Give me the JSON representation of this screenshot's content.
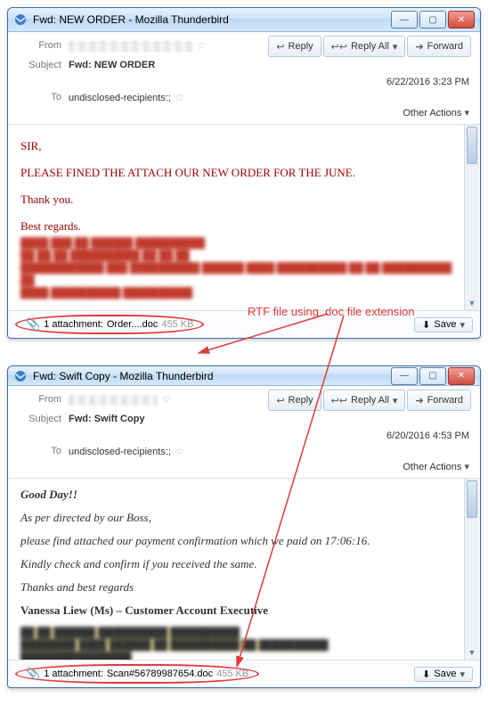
{
  "annotation": {
    "label": "RTF file using .doc file extension"
  },
  "email1": {
    "titlebar": "Fwd: NEW ORDER - Mozilla Thunderbird",
    "header": {
      "from_label": "From",
      "subject_label": "Subject",
      "subject_value": "Fwd: NEW ORDER",
      "to_label": "To",
      "to_value": "undisclosed-recipients:;",
      "reply": "Reply",
      "reply_all": "Reply All",
      "forward": "Forward",
      "date": "6/22/2016 3:23 PM",
      "other_actions": "Other Actions"
    },
    "body": {
      "line1": "SIR,",
      "line2": "PLEASE FINED THE ATTACH OUR NEW ORDER FOR THE JUNE.",
      "line3": "Thank you.",
      "line4": "Best regards."
    },
    "attachment": {
      "count_label": "1 attachment:",
      "filename": "Order....doc",
      "size": "455 KB",
      "save_label": "Save"
    }
  },
  "email2": {
    "titlebar": "Fwd: Swift Copy - Mozilla Thunderbird",
    "header": {
      "from_label": "From",
      "subject_label": "Subject",
      "subject_value": "Fwd: Swift Copy",
      "to_label": "To",
      "to_value": "undisclosed-recipients:;",
      "reply": "Reply",
      "reply_all": "Reply All",
      "forward": "Forward",
      "date": "6/20/2016 4:53 PM",
      "other_actions": "Other Actions"
    },
    "body": {
      "line1": "Good Day!!",
      "line2": "As per directed by our Boss,",
      "line3": "please find attached our payment confirmation which we paid on 17:06:16.",
      "line4": "Kindly check and confirm if you received the same.",
      "line5": "Thanks and best regards",
      "line6": "Vanessa Liew (Ms) – Customer Account Executive"
    },
    "attachment": {
      "count_label": "1 attachment:",
      "filename": "Scan#56789987654.doc",
      "size": "455 KB",
      "save_label": "Save"
    }
  }
}
